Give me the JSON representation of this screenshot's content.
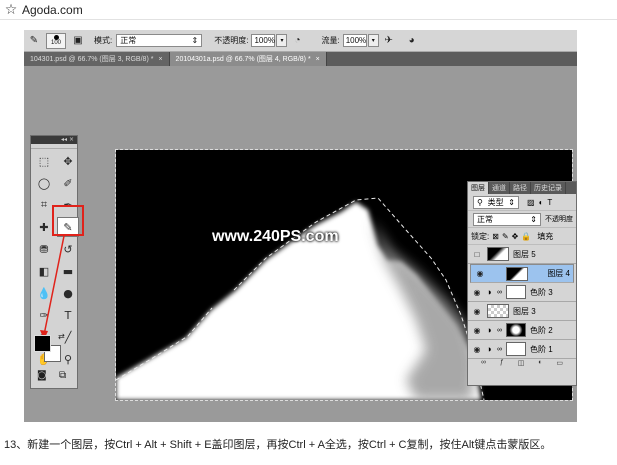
{
  "browser": {
    "favorite_icon": "star-icon",
    "title": "Agoda.com"
  },
  "options_bar": {
    "brush_size": "100",
    "mode_label": "模式:",
    "mode_value": "正常",
    "opacity_label": "不透明度:",
    "opacity_value": "100%",
    "flow_label": "流量:",
    "flow_value": "100%"
  },
  "doc_tabs": [
    {
      "label": "104301.psd @ 66.7% (图层 3, RGB/8) *",
      "close": "×"
    },
    {
      "label": "20104301a.psd @ 66.7% (图层 4, RGB/8) *",
      "close": "×"
    }
  ],
  "watermark": "www.240PS.com",
  "toolbar": {
    "collapse": "◂◂ ×"
  },
  "layers_panel": {
    "tabs": [
      "图层",
      "通道",
      "路径",
      "历史记录"
    ],
    "kind_label": "类型",
    "blend_value": "正常",
    "opacity_label": "不透明度",
    "lock_label": "锁定:",
    "fill_label": "填充",
    "layers": [
      {
        "name": "图层 5"
      },
      {
        "name": "图层 4"
      },
      {
        "name": "色阶 3"
      },
      {
        "name": "图层 3"
      },
      {
        "name": "色阶 2"
      },
      {
        "name": "色阶 1"
      }
    ]
  },
  "caption": "13、新建一个图层，按Ctrl + Alt + Shift + E盖印图层，再按Ctrl + A全选，按Ctrl + C复制，按住Alt键点击蒙版区。"
}
